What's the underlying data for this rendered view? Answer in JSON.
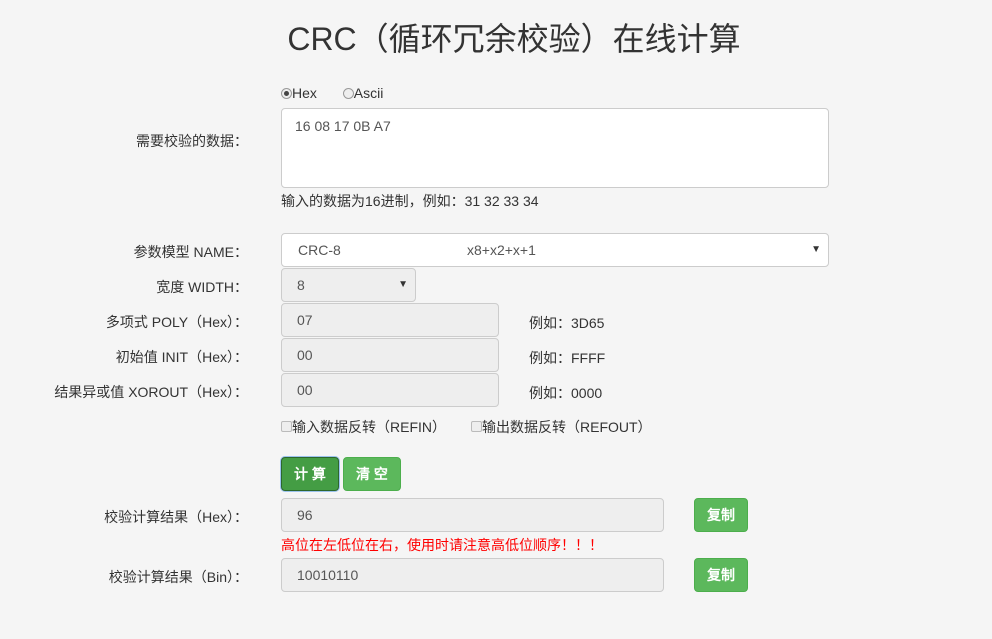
{
  "title": "CRC（循环冗余校验）在线计算",
  "format": {
    "hex": "Hex",
    "ascii": "Ascii",
    "selected": "Hex"
  },
  "data": {
    "label": "需要校验的数据：",
    "value": "16 08 17 0B A7",
    "hint": "输入的数据为16进制，例如：31 32 33 34"
  },
  "model": {
    "label": "参数模型 NAME：",
    "name": "CRC-8",
    "poly_expr": "x8+x2+x+1"
  },
  "width": {
    "label": "宽度 WIDTH：",
    "value": "8"
  },
  "poly": {
    "label": "多项式 POLY（Hex）：",
    "value": "07",
    "example": "例如：3D65"
  },
  "init": {
    "label": "初始值 INIT（Hex）：",
    "value": "00",
    "example": "例如：FFFF"
  },
  "xorout": {
    "label": "结果异或值 XOROUT（Hex）：",
    "value": "00",
    "example": "例如：0000"
  },
  "refin": {
    "label": "输入数据反转（REFIN）",
    "checked": false
  },
  "refout": {
    "label": "输出数据反转（REFOUT）",
    "checked": false
  },
  "buttons": {
    "calc": "计 算",
    "clear": "清 空",
    "copy": "复制"
  },
  "result_hex": {
    "label": "校验计算结果（Hex）：",
    "value": "96",
    "warning": "高位在左低位在右，使用时请注意高低位顺序！！！"
  },
  "result_bin": {
    "label": "校验计算结果（Bin）：",
    "value": "10010110"
  },
  "colors": {
    "primary_green": "#5cb85c",
    "active_green": "#449d44",
    "warning": "#ff0000"
  }
}
